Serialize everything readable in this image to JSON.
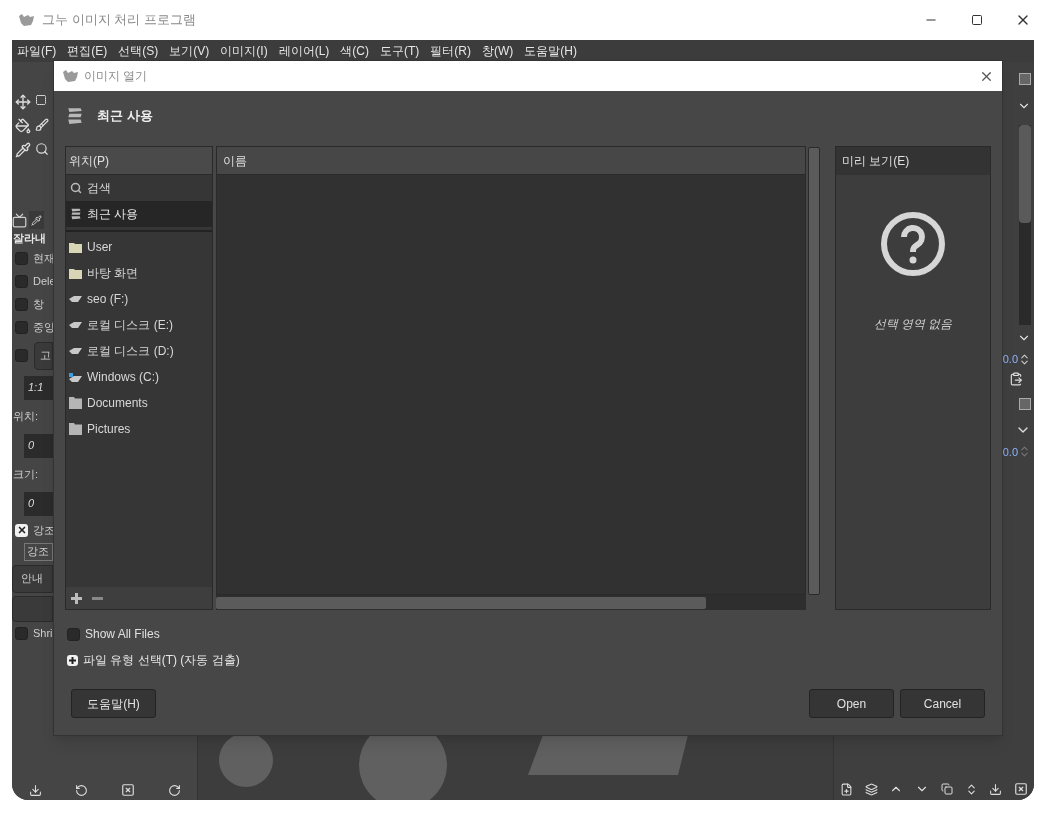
{
  "window": {
    "title": "그누 이미지 처리 프로그램"
  },
  "menu": [
    "파일(F)",
    "편집(E)",
    "선택(S)",
    "보기(V)",
    "이미지(I)",
    "레이어(L)",
    "색(C)",
    "도구(T)",
    "필터(R)",
    "창(W)",
    "도움말(H)"
  ],
  "left_dock": {
    "title": "잘라내",
    "options": [
      {
        "kind": "checkbox",
        "label": "현재",
        "checked": false
      },
      {
        "kind": "checkbox",
        "label": "Dele",
        "checked": false
      },
      {
        "kind": "checkbox",
        "label": "창",
        "checked": false
      },
      {
        "kind": "checkbox",
        "label": "중앙",
        "checked": false
      },
      {
        "kind": "checkbox-combo",
        "label": "고",
        "checked": false
      },
      {
        "kind": "field",
        "value": "1:1"
      },
      {
        "kind": "label",
        "label": "위치:"
      },
      {
        "kind": "field",
        "value": "0"
      },
      {
        "kind": "label",
        "label": "크기:"
      },
      {
        "kind": "field",
        "value": "0"
      },
      {
        "kind": "checkbox",
        "label": "강조",
        "checked": true
      },
      {
        "kind": "combo",
        "label": "강조"
      },
      {
        "kind": "button",
        "label": "안내"
      },
      {
        "kind": "empty-button"
      },
      {
        "kind": "checkbox",
        "label": "Shri",
        "checked": false
      }
    ]
  },
  "right_dock": {
    "values": [
      "0.0",
      "0.0"
    ]
  },
  "dialog": {
    "title": "이미지 열기",
    "location": "최근 사용",
    "places_header": "위치(P)",
    "places": [
      [
        {
          "kind": "search",
          "label": "검색",
          "selected": false
        },
        {
          "kind": "recent",
          "label": "최근 사용",
          "selected": true
        }
      ],
      [
        {
          "kind": "folder",
          "label": "User",
          "selected": false
        },
        {
          "kind": "folder",
          "label": "바탕 화면",
          "selected": false
        },
        {
          "kind": "drive",
          "label": "seo (F:)",
          "selected": false
        },
        {
          "kind": "drive",
          "label": "로컬 디스크 (E:)",
          "selected": false
        },
        {
          "kind": "drive",
          "label": "로컬 디스크 (D:)",
          "selected": false
        },
        {
          "kind": "system-drive",
          "label": "Windows (C:)",
          "selected": false
        },
        {
          "kind": "gray-folder",
          "label": "Documents",
          "selected": false
        },
        {
          "kind": "gray-folder",
          "label": "Pictures",
          "selected": false
        }
      ]
    ],
    "files_header": "이름",
    "preview_header": "미리 보기(E)",
    "preview_message": "선택 영역 없음",
    "show_all_files": {
      "label": "Show All Files",
      "checked": false
    },
    "file_type": {
      "label": "파일 유형 선택(T) (자동 검출)",
      "expanded": false
    },
    "buttons": [
      {
        "label": "도움말(H)"
      },
      {
        "label": "Open"
      },
      {
        "label": "Cancel"
      }
    ]
  }
}
